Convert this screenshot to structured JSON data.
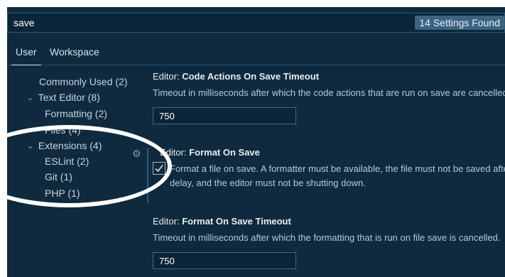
{
  "search": {
    "value": "save",
    "result_count": "14 Settings Found"
  },
  "tabs": [
    {
      "label": "User",
      "active": true
    },
    {
      "label": "Workspace",
      "active": false
    }
  ],
  "toc": {
    "commonly_used": "Commonly Used (2)",
    "text_editor": "Text Editor (8)",
    "formatting": "Formatting (2)",
    "files": "Files (4)",
    "extensions": "Extensions (4)",
    "eslint": "ESLint (2)",
    "git": "Git (1)",
    "php": "PHP (1)"
  },
  "settings": [
    {
      "category": "Editor: ",
      "name": "Code Actions On Save Timeout",
      "description": "Timeout in milliseconds after which the code actions that are run on save are cancelled.",
      "value": "750"
    },
    {
      "category": "Editor: ",
      "name": "Format On Save",
      "description_line1": "Format a file on save. A formatter must be available, the file must not be saved after",
      "description_line2": "delay, and the editor must not be shutting down.",
      "checked": true
    },
    {
      "category": "Editor: ",
      "name": "Format On Save Timeout",
      "description": "Timeout in milliseconds after which the formatting that is run on file save is cancelled.",
      "value": "750"
    }
  ],
  "colors": {
    "background": "#0f2a3f",
    "accent": "#3c6382",
    "annotation_ring": "#ffffff"
  }
}
